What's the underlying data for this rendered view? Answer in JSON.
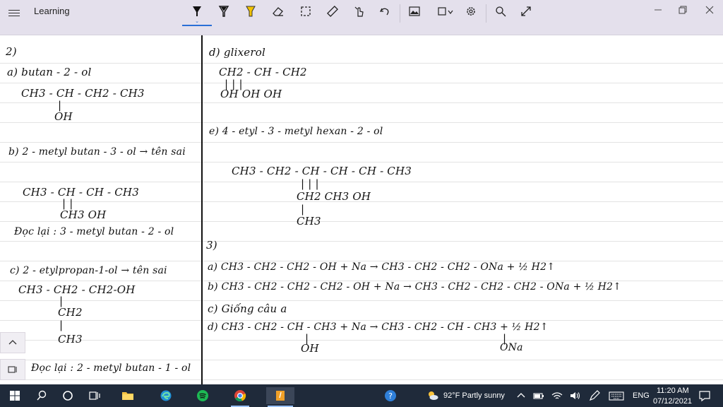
{
  "app": {
    "title": "Learning"
  },
  "toolbar": {
    "tools": [
      "ballpoint-pen",
      "pencil",
      "highlighter",
      "eraser",
      "lasso-select",
      "ruler",
      "touch-writing",
      "undo",
      "add-image",
      "shapes",
      "settings",
      "zoom",
      "expand"
    ]
  },
  "notes": {
    "left": [
      "2)",
      "a)  butan - 2 - ol",
      "CH3 - CH - CH2 - CH3",
      "|",
      "OH",
      "b)  2 - metyl butan - 3 - ol → tên sai",
      "CH3 - CH - CH - CH3",
      "|        |",
      "CH3   OH",
      "Đọc lại :  3 - metyl butan - 2 - ol",
      "c)  2 - etylpropan-1-ol → tên sai",
      "CH3  -  CH2 - CH2-OH",
      "|",
      "CH2",
      "|",
      "CH3",
      "Đọc lại :  2 - metyl butan - 1 - ol"
    ],
    "right": [
      "d)  glixerol",
      "CH2 - CH -  CH2",
      "|          |          |",
      "OH    OH    OH",
      "e)  4 - etyl - 3 - metyl hexan - 2 - ol",
      "CH3 - CH2 -  CH - CH -  CH - CH3",
      "|           |           |",
      "CH2       CH3      OH",
      "|",
      "CH3",
      "3)",
      "a)  CH3 - CH2 - CH2 - OH  +  Na  →  CH3 - CH2 - CH2 - ONa  +  ½ H2↑",
      "b)  CH3 - CH2 - CH2 - CH2 - OH  +  Na  →  CH3 - CH2 - CH2 - CH2 - ONa  +  ½ H2↑",
      "c)  Giống câu a",
      "d)  CH3 - CH2 - CH - CH3   +  Na   →   CH3 - CH2 - CH - CH3   +  ½ H2↑",
      "|",
      "OH",
      "|",
      "ONa"
    ]
  },
  "taskbar": {
    "weather": "92°F  Partly sunny",
    "language": "ENG",
    "time": "11:20 AM",
    "date": "07/12/2021"
  },
  "colors": {
    "titlebar_bg": "#e4e0ec",
    "accent": "#2a6fd6",
    "highlighter": "#f2c200",
    "taskbar_bg": "#1f2a3a",
    "ink": "#111111"
  }
}
